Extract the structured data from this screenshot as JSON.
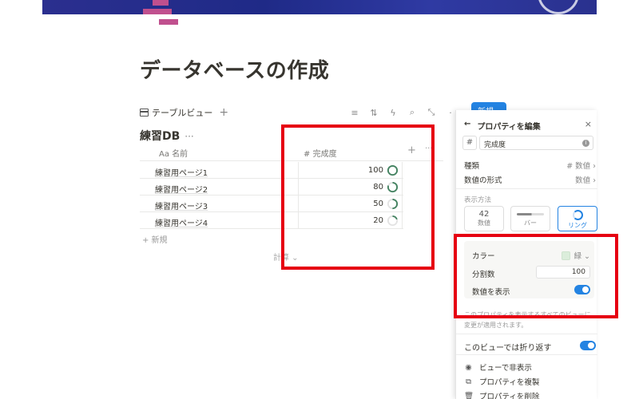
{
  "page": {
    "title": "データベースの作成"
  },
  "view_bar": {
    "tab_label": "テーブルビュー",
    "add_icon": "plus-icon",
    "new_button_label": "新規",
    "toolbar_icons": [
      "filter-icon",
      "sort-icon",
      "lightning-icon",
      "search-icon",
      "expand-icon",
      "more-icon"
    ]
  },
  "database": {
    "title": "練習DB",
    "more": "···",
    "columns": {
      "name_prefix": "Aa",
      "name": "名前",
      "progress_prefix": "#",
      "progress": "完成度"
    },
    "rows": [
      {
        "name": "練習用ページ1",
        "value": "100",
        "fraction": 1.0
      },
      {
        "name": "練習用ページ2",
        "value": "80",
        "fraction": 0.8
      },
      {
        "name": "練習用ページ3",
        "value": "50",
        "fraction": 0.5
      },
      {
        "name": "練習用ページ4",
        "value": "20",
        "fraction": 0.2
      }
    ],
    "new_row": "+ 新規",
    "calculate": "計算 ⌄"
  },
  "panel": {
    "back": "←",
    "title": "プロパティを編集",
    "close": "×",
    "name_prefix": "#",
    "name_value": "完成度",
    "type_label": "種類",
    "type_value": "# 数値 ›",
    "format_label": "数値の形式",
    "format_value": "数値 ›",
    "display_label": "表示方法",
    "display_options": [
      {
        "top": "42",
        "label": "数値"
      },
      {
        "top": "",
        "label": "バー"
      },
      {
        "top": "",
        "label": "リング"
      }
    ],
    "color_label": "カラー",
    "color_value": "緑 ⌄",
    "color_hex": "#dbeddb",
    "divide_label": "分割数",
    "divide_value": "100",
    "show_value_label": "数値を表示",
    "show_value_on": true,
    "note": "このプロパティを表示するすべてのビューに変更が適用されます。",
    "wrap_label": "このビューでは折り返す",
    "wrap_on": true,
    "actions": [
      {
        "icon": "eye-icon",
        "label": "ビューで非表示"
      },
      {
        "icon": "copy-icon",
        "label": "プロパティを複製"
      },
      {
        "icon": "trash-icon",
        "label": "プロパティを削除"
      }
    ]
  },
  "colors": {
    "accent": "#2383e2",
    "ring_green": "#448361",
    "highlight_red": "#e60012"
  }
}
